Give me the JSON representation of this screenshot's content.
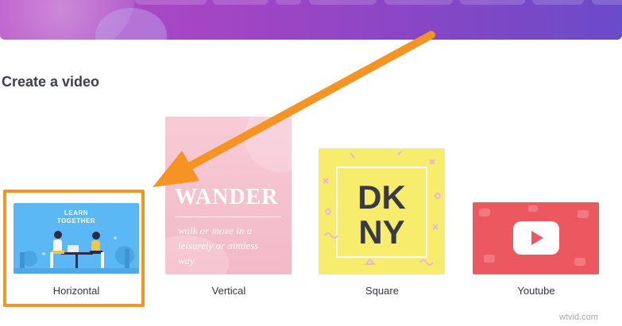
{
  "section": {
    "title": "Create a video"
  },
  "cards": [
    {
      "label": "Horizontal",
      "thumb": {
        "line1": "LEARN",
        "line2": "TOGETHER"
      }
    },
    {
      "label": "Vertical",
      "thumb": {
        "title": "WANDER",
        "body_line1": "walk or move in a",
        "body_line2": "leisurely or aimless",
        "body_line3": "way."
      }
    },
    {
      "label": "Square",
      "thumb": {
        "line1": "DK",
        "line2": "NY"
      }
    },
    {
      "label": "Youtube",
      "thumb": {
        "icon": "play-icon"
      }
    }
  ],
  "highlight": {
    "selected_card": "Horizontal",
    "color": "#f59422"
  },
  "colors": {
    "banner_start": "#b64cc6",
    "banner_end": "#6a4bc8",
    "title": "#3c3d55",
    "horizontal_bg": "#5bb8f4",
    "vertical_bg": "#f5c9d4",
    "square_bg": "#f8ec6c",
    "youtube_bg": "#ec5860"
  },
  "watermark": "wtvid.com"
}
